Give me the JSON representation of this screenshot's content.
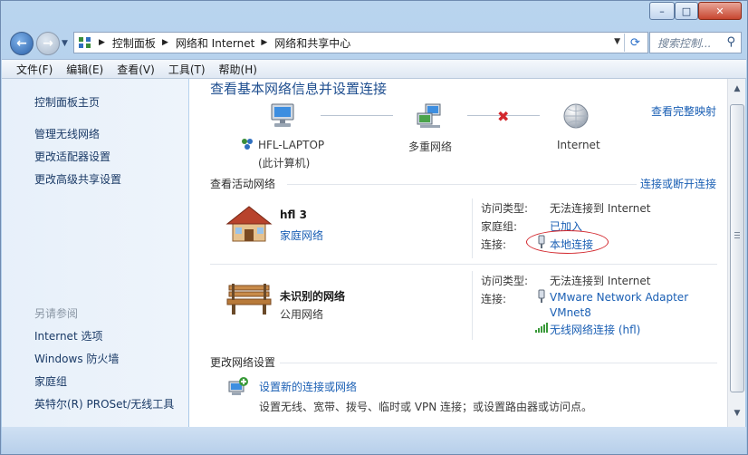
{
  "window": {
    "controls": {
      "minimize": "–",
      "maximize": "□",
      "close": "✕"
    }
  },
  "nav": {
    "breadcrumbs": [
      "控制面板",
      "网络和 Internet",
      "网络和共享中心"
    ],
    "search_placeholder": "搜索控制..."
  },
  "menu": [
    "文件(F)",
    "编辑(E)",
    "查看(V)",
    "工具(T)",
    "帮助(H)"
  ],
  "sidebar": {
    "home": "控制面板主页",
    "links": [
      "管理无线网络",
      "更改适配器设置",
      "更改高级共享设置"
    ],
    "see_also_heading": "另请参阅",
    "see_also": [
      "Internet 选项",
      "Windows 防火墙",
      "家庭组",
      "英特尔(R) PROSet/无线工具"
    ]
  },
  "main": {
    "title": "查看基本网络信息并设置连接",
    "view_full_map": "查看完整映射",
    "map": {
      "computer_name": "HFL-LAPTOP",
      "computer_sub": "(此计算机)",
      "middle": "多重网络",
      "internet": "Internet"
    },
    "active_heading": "查看活动网络",
    "connect_disconnect": "连接或断开连接",
    "networks": [
      {
        "name": "hfl  3",
        "type": "家庭网络",
        "access_label": "访问类型:",
        "access_value": "无法连接到 Internet",
        "homegroup_label": "家庭组:",
        "homegroup_value": "已加入",
        "conn_label": "连接:",
        "conn_value": "本地连接"
      },
      {
        "name": "未识别的网络",
        "type": "公用网络",
        "access_label": "访问类型:",
        "access_value": "无法连接到 Internet",
        "conn_label": "连接:",
        "conn_value_1": "VMware Network Adapter",
        "conn_value_2": "VMnet8",
        "conn_value_3": "无线网络连接 (hfl)"
      }
    ],
    "change_heading": "更改网络设置",
    "setup": {
      "link": "设置新的连接或网络",
      "desc": "设置无线、宽带、拨号、临时或 VPN 连接；或设置路由器或访问点。"
    }
  },
  "colors": {
    "link": "#1a5fb4",
    "title": "#1e4e8f",
    "error_x": "#d2272d",
    "sidebar_bg": "#e7f0fa"
  }
}
